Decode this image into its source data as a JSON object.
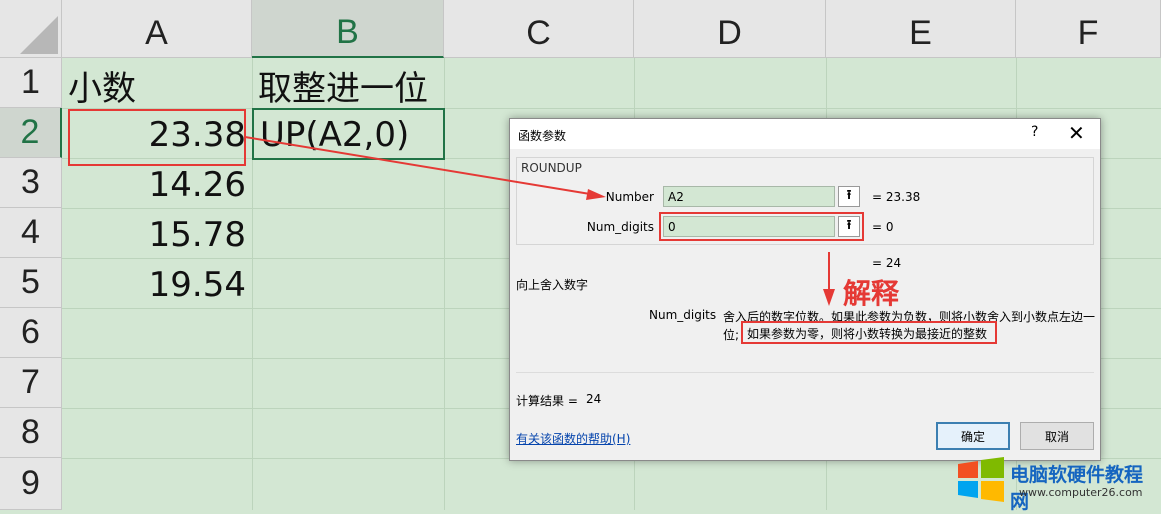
{
  "sheet": {
    "columns": [
      "A",
      "B",
      "C",
      "D",
      "E",
      "F"
    ],
    "rows": [
      "1",
      "2",
      "3",
      "4",
      "5",
      "6",
      "7",
      "8",
      "9"
    ],
    "a1": "小数",
    "b1": "取整进一位",
    "b2": "UP(A2,0)",
    "values": [
      "23.38",
      "14.26",
      "15.78",
      "19.54"
    ]
  },
  "dialog": {
    "title": "函数参数",
    "help_glyph": "?",
    "close_glyph": "✕",
    "function_name": "ROUNDUP",
    "number_label": "Number",
    "number_value": "A2",
    "number_result": "=  23.38",
    "digits_label": "Num_digits",
    "digits_value": "0",
    "digits_result": "=  0",
    "formula_result": "=  24",
    "description": "向上舍入数字",
    "arg_name": "Num_digits",
    "arg_desc_1": "舍入后的数字位数。如果此参数为负数，则将小数舍入到小数点左边一",
    "arg_desc_2_prefix": "位;",
    "arg_desc_2_highlight": "如果参数为零，则将小数转换为最接近的整数",
    "calc_label": "计算结果 =",
    "calc_value": "24",
    "help_link": "有关该函数的帮助(H)",
    "ok": "确定",
    "cancel": "取消",
    "collapse_glyph": "⭱"
  },
  "annotation": {
    "text": "解释"
  },
  "watermark": {
    "brand": "电脑软硬件教程网",
    "url": "www.computer26.com"
  },
  "colors": {
    "sheet_bg": "#d3e7d3",
    "header_bg": "#e6e6e6",
    "excel_green": "#217346",
    "annotation_red": "#e53935"
  }
}
